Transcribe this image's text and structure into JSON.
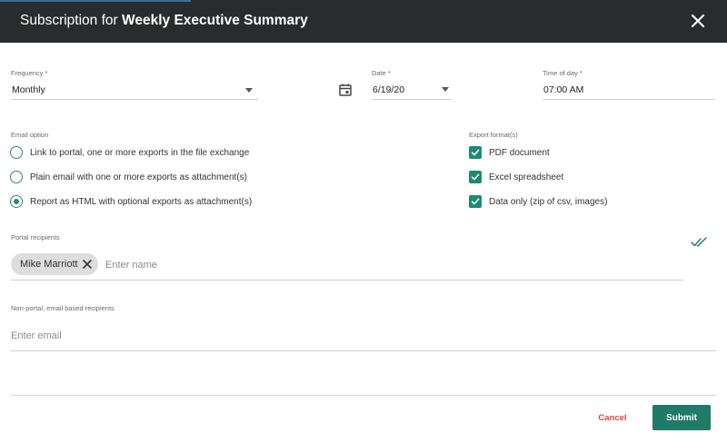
{
  "header": {
    "title_prefix": "Subscription for ",
    "title_report": "Weekly Executive Summary"
  },
  "frequency": {
    "label": "Frequency *",
    "value": "Monthly"
  },
  "date": {
    "label": "Date *",
    "value": "6/19/20"
  },
  "time": {
    "label": "Time of day *",
    "value": "07:00 AM"
  },
  "email_option": {
    "label": "Email option",
    "options": [
      {
        "label": "Link to portal, one or more exports in the file exchange",
        "selected": false
      },
      {
        "label": "Plain email with one or more exports as attachment(s)",
        "selected": false
      },
      {
        "label": "Report as HTML with optional exports as attachment(s)",
        "selected": true
      }
    ]
  },
  "export_formats": {
    "label": "Export format(s)",
    "options": [
      {
        "label": "PDF document",
        "checked": true
      },
      {
        "label": "Excel spreadsheet",
        "checked": true
      },
      {
        "label": "Data only (zip of csv, images)",
        "checked": true
      }
    ]
  },
  "portal_recipients": {
    "label": "Portal recipients",
    "chips": [
      "Mike Marriott"
    ],
    "placeholder": "Enter name"
  },
  "email_recipients": {
    "label": "Non-portal, email based recipients",
    "placeholder": "Enter email"
  },
  "actions": {
    "cancel": "Cancel",
    "submit": "Submit"
  },
  "colors": {
    "header_bg": "#2a2b2d",
    "accent": "#1f7a68",
    "cancel": "#d9463a"
  }
}
